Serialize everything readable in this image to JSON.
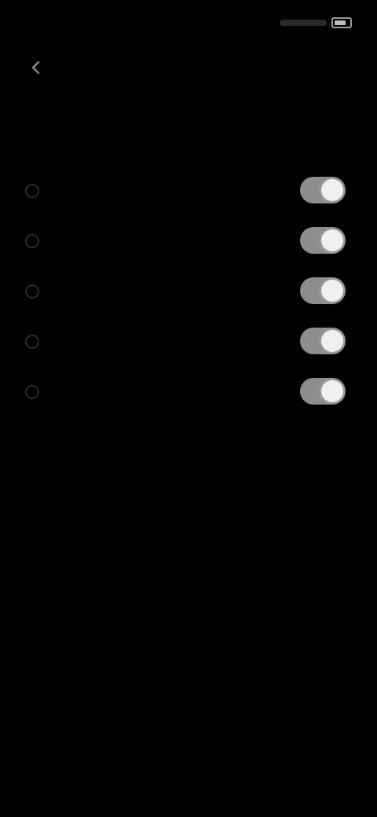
{
  "status_bar": {
    "time": "",
    "battery_icon": "battery-icon"
  },
  "header": {
    "back_icon": "arrow-left-icon",
    "title": ""
  },
  "settings": {
    "rows": [
      {
        "icon": "setting-icon",
        "label": "",
        "toggle_on": true
      },
      {
        "icon": "setting-icon",
        "label": "",
        "toggle_on": true
      },
      {
        "icon": "setting-icon",
        "label": "",
        "toggle_on": true
      },
      {
        "icon": "setting-icon",
        "label": "",
        "toggle_on": true
      },
      {
        "icon": "setting-icon",
        "label": "",
        "toggle_on": true
      }
    ]
  },
  "colors": {
    "background": "#000000",
    "toggle_track_on": "#8d8d8d",
    "toggle_knob": "#f0f0f0"
  }
}
